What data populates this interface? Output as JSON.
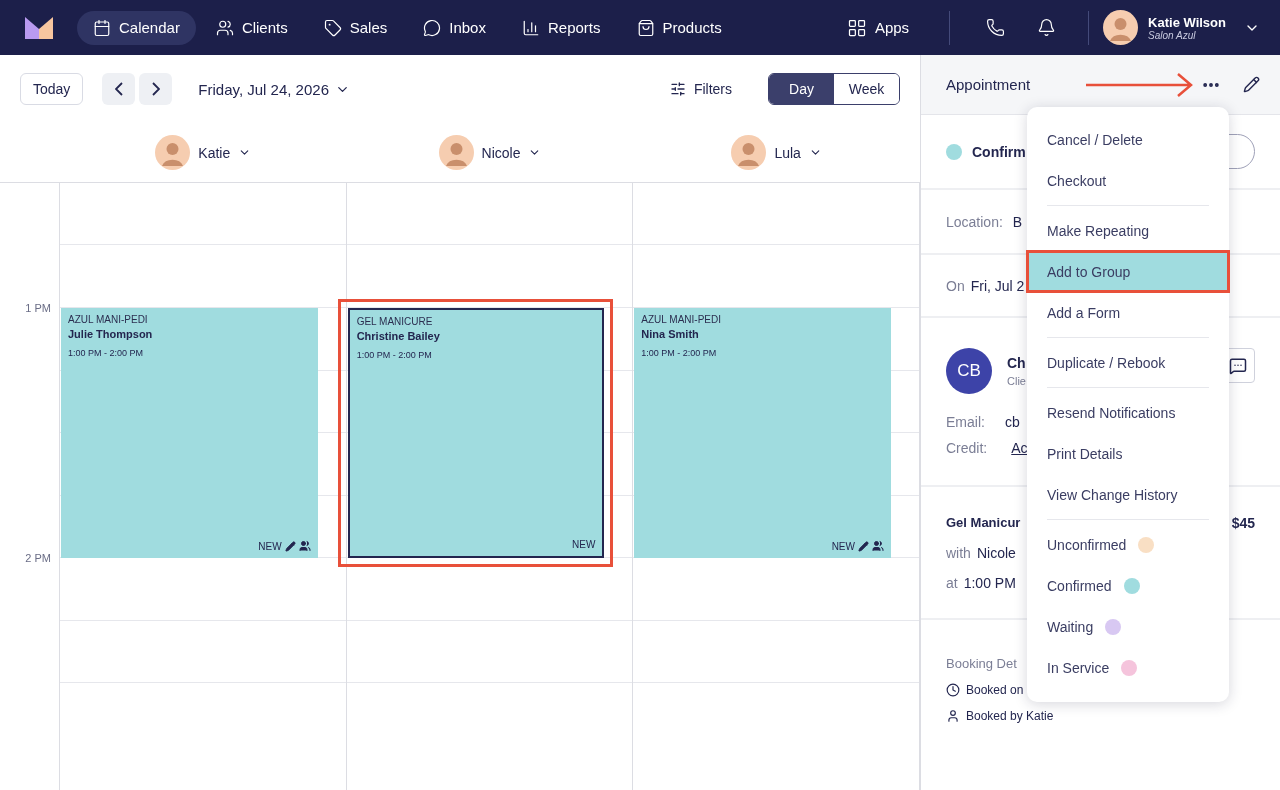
{
  "nav": {
    "items": [
      {
        "label": "Calendar",
        "selected": true
      },
      {
        "label": "Clients",
        "selected": false
      },
      {
        "label": "Sales",
        "selected": false
      },
      {
        "label": "Inbox",
        "selected": false
      },
      {
        "label": "Reports",
        "selected": false
      },
      {
        "label": "Products",
        "selected": false
      }
    ],
    "apps": "Apps",
    "user": {
      "name": "Katie Wilson",
      "subtitle": "Salon Azul"
    }
  },
  "toolbar": {
    "today": "Today",
    "date": "Friday, Jul 24, 2026",
    "filters": "Filters",
    "views": [
      {
        "label": "Day",
        "selected": true
      },
      {
        "label": "Week",
        "selected": false
      }
    ]
  },
  "staff": [
    {
      "name": "Katie"
    },
    {
      "name": "Nicole"
    },
    {
      "name": "Lula"
    }
  ],
  "time_labels": [
    "1 PM",
    "2 PM"
  ],
  "appointments": [
    {
      "service": "AZUL MANI-PEDI",
      "client": "Julie Thompson",
      "time": "1:00 PM - 2:00 PM",
      "badge": "NEW",
      "pencil_mark": true,
      "group_mark": true,
      "selected": false,
      "highlighted": false
    },
    {
      "service": "GEL MANICURE",
      "client": "Christine Bailey",
      "time": "1:00 PM - 2:00 PM",
      "badge": "NEW",
      "pencil_mark": false,
      "group_mark": false,
      "selected": true,
      "highlighted": true
    },
    {
      "service": "AZUL MANI-PEDI",
      "client": "Nina Smith",
      "time": "1:00 PM - 2:00 PM",
      "badge": "NEW",
      "pencil_mark": true,
      "group_mark": true,
      "selected": false,
      "highlighted": false
    }
  ],
  "panel": {
    "title": "Appointment",
    "status": {
      "label": "Confirm",
      "color": "#a0dcdf"
    },
    "location": {
      "label": "Location:",
      "value": "B"
    },
    "date": {
      "label": "On",
      "value": "Fri, Jul 2"
    },
    "client": {
      "initials": "CB",
      "name": "Ch",
      "subtitle": "Clie",
      "email_label": "Email:",
      "email": "cb",
      "credit_label": "Credit:",
      "credit": "Ac"
    },
    "service": {
      "name": "Gel Manicur",
      "price": "$45",
      "with_label": "with",
      "with": "Nicole",
      "at_label": "at",
      "at": "1:00 PM"
    },
    "booking": {
      "heading": "Booking Det",
      "booked_on": "Booked on",
      "booked_by": "Booked by Katie"
    }
  },
  "menu": {
    "groups": [
      [
        {
          "label": "Cancel / Delete",
          "highlighted": false
        },
        {
          "label": "Checkout",
          "highlighted": false
        }
      ],
      [
        {
          "label": "Make Repeating",
          "highlighted": false
        },
        {
          "label": "Add to Group",
          "highlighted": true
        },
        {
          "label": "Add a Form",
          "highlighted": false
        }
      ],
      [
        {
          "label": "Duplicate / Rebook",
          "highlighted": false
        }
      ],
      [
        {
          "label": "Resend Notifications",
          "highlighted": false
        },
        {
          "label": "Print Details",
          "highlighted": false
        },
        {
          "label": "View Change History",
          "highlighted": false
        }
      ],
      [
        {
          "label": "Unconfirmed",
          "highlighted": false,
          "color": "#f9dfc4"
        },
        {
          "label": "Confirmed",
          "highlighted": false,
          "color": "#a0dcdf"
        },
        {
          "label": "Waiting",
          "highlighted": false,
          "color": "#d8c8f2"
        },
        {
          "label": "In Service",
          "highlighted": false,
          "color": "#f5c4dc"
        }
      ]
    ]
  }
}
